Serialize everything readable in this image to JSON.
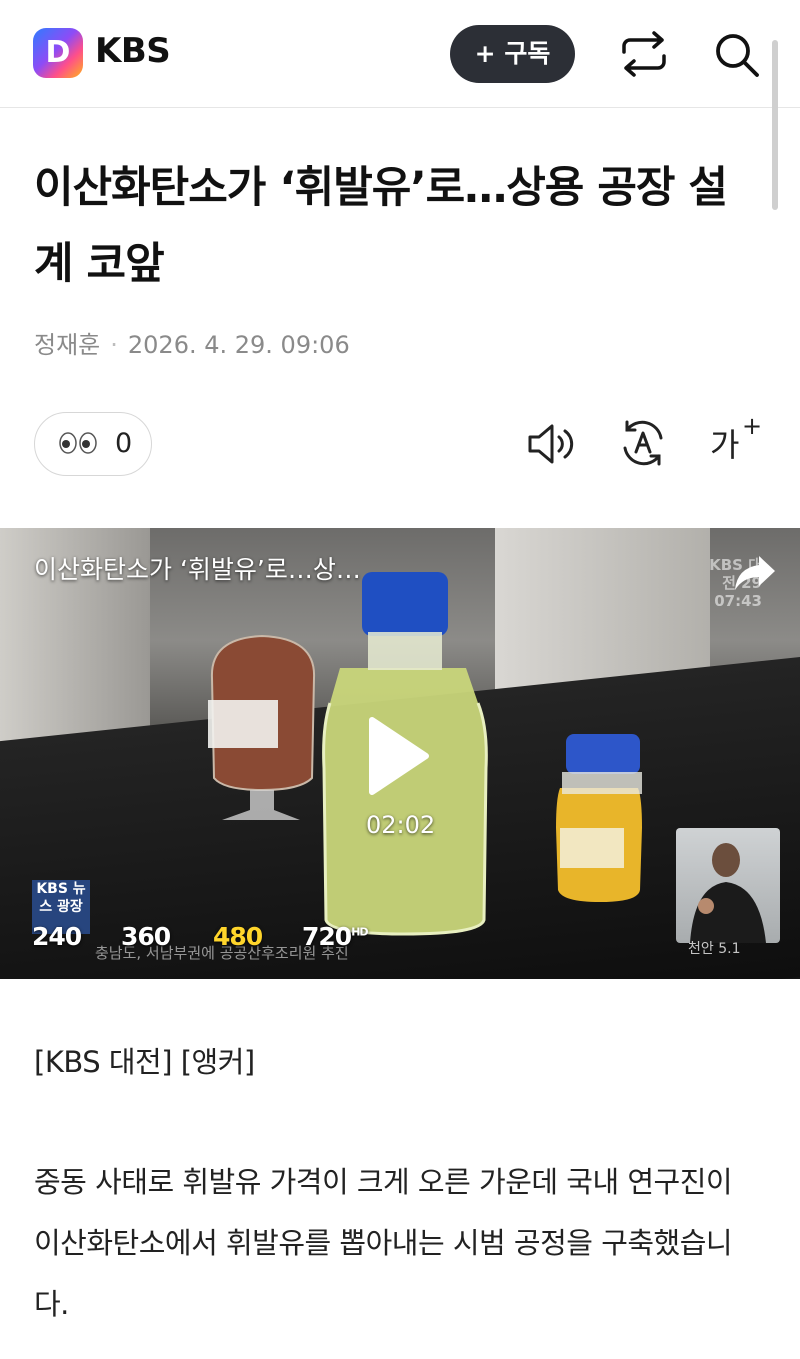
{
  "header": {
    "logo_letter": "D",
    "brand": "KBS",
    "subscribe_label": "+ 구독"
  },
  "article": {
    "title": "이산화탄소가 ‘휘발유’로…상용 공장 설계 코앞",
    "author": "정재훈",
    "datetime": "2026. 4. 29. 09:06",
    "reaction_count": "0"
  },
  "tools": {
    "listen_icon": "speaker-icon",
    "translate_icon": "translate-icon",
    "font_size_label": "가"
  },
  "video": {
    "title": "이산화탄소가 ‘휘발유’로…상…",
    "duration": "02:02",
    "qualities": [
      "240",
      "360",
      "480",
      "720"
    ],
    "selected_quality": "480",
    "hd_badge": "HD",
    "watermark": "KBS 대전 29 07:43",
    "tv_logo": "KBS 뉴스 광장",
    "ticker": "충남도, 서남부권에 공공산후조리원 추진",
    "weather": "천안 5.1"
  },
  "body": {
    "line1": "[KBS 대전] [앵커]",
    "paragraph": "중동 사태로 휘발유 가격이 크게 오른 가운데 국내 연구진이 이산화탄소에서 휘발유를 뽑아내는 시범 공정을 구축했습니다."
  },
  "colors": {
    "quality_selected": "#ffd52b",
    "subscribe_bg": "#2c2f36"
  }
}
